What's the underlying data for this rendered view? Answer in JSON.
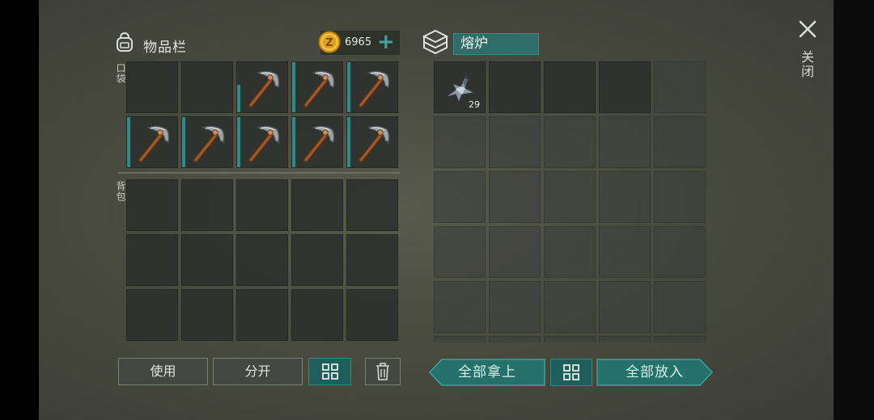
{
  "inventory": {
    "title": "物品栏",
    "coins": "6965",
    "pocket_label": "口袋",
    "backpack_label": "背包",
    "pocket_slots": [
      {
        "item": null,
        "bar": 0
      },
      {
        "item": null,
        "bar": 0
      },
      {
        "item": "pickaxe",
        "bar": 0.55
      },
      {
        "item": "pickaxe",
        "bar": 1
      },
      {
        "item": "pickaxe",
        "bar": 1
      },
      {
        "item": "pickaxe",
        "bar": 1
      },
      {
        "item": "pickaxe",
        "bar": 1
      },
      {
        "item": "pickaxe",
        "bar": 1
      },
      {
        "item": "pickaxe",
        "bar": 1
      },
      {
        "item": "pickaxe",
        "bar": 1
      }
    ],
    "backpack_slot_count": 15
  },
  "furnace": {
    "title": "熔炉",
    "slots": [
      {
        "item": "metal-fragment",
        "qty": "29"
      }
    ],
    "slot_count": 30
  },
  "close_label": "关闭",
  "buttons": {
    "use": "使用",
    "split": "分开",
    "take_all": "全部拿上",
    "put_all": "全部放入"
  },
  "colors": {
    "accent": "#2b8d8a",
    "title_box": "#2f6e68",
    "coin": "#e0a21a"
  },
  "icons": [
    "backpack-icon",
    "coin-icon",
    "plus-icon",
    "furnace-icon",
    "close-icon",
    "pickaxe-icon",
    "metal-fragment-icon",
    "grid-icon",
    "trash-icon"
  ]
}
